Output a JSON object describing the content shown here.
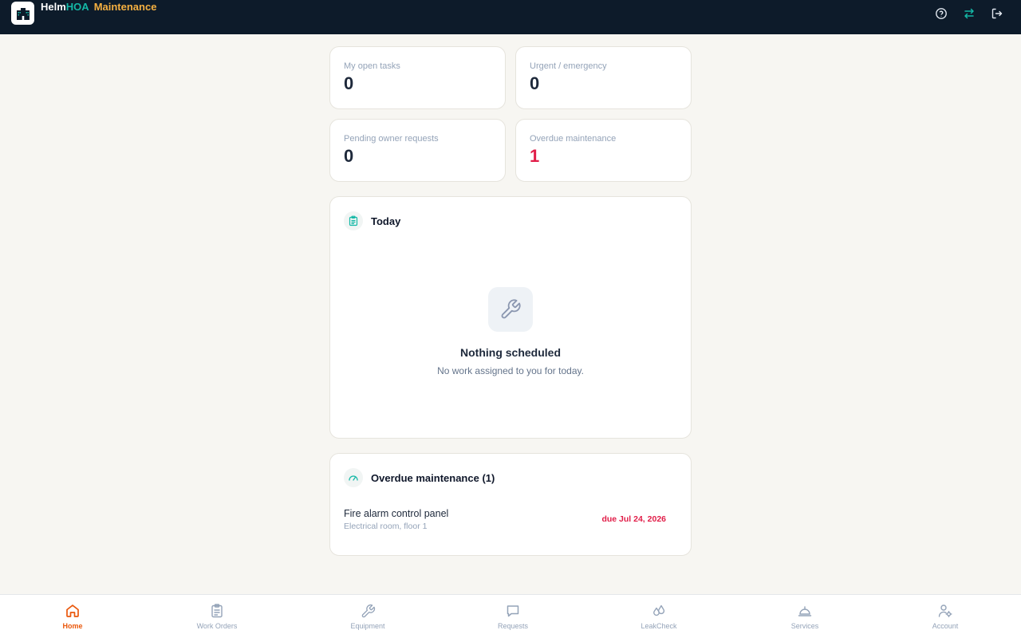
{
  "app": {
    "brand_part1": "Helm",
    "brand_part2": "HOA",
    "brand_part3": "Maintenance"
  },
  "header_icons": [
    "help-circle-icon",
    "switch-arrows-icon",
    "logout-icon"
  ],
  "stats": [
    {
      "label": "My open tasks",
      "value": "0"
    },
    {
      "label": "Urgent / emergency",
      "value": "0"
    },
    {
      "label": "Pending owner requests",
      "value": "0"
    },
    {
      "label": "Overdue maintenance",
      "value": "1"
    }
  ],
  "today": {
    "title": "Today",
    "empty_title": "Nothing scheduled",
    "empty_desc": "No work assigned to you for today."
  },
  "overdue": {
    "title": "Overdue maintenance (1)",
    "items": [
      {
        "name": "Fire alarm control panel",
        "location": "Electrical room, floor 1",
        "due": "due Jul 24, 2026"
      }
    ]
  },
  "nav": {
    "items": [
      {
        "label": "Home",
        "icon": "home-icon",
        "active": true
      },
      {
        "label": "Work Orders",
        "icon": "clipboard-icon"
      },
      {
        "label": "Equipment",
        "icon": "wrench-icon"
      },
      {
        "label": "Requests",
        "icon": "chat-icon"
      },
      {
        "label": "LeakCheck",
        "icon": "droplets-icon"
      },
      {
        "label": "Services",
        "icon": "service-bell-icon"
      },
      {
        "label": "Account",
        "icon": "user-settings-icon"
      }
    ]
  },
  "colors": {
    "header_bg": "#0d1b2a",
    "accent_teal": "#14b8a6",
    "accent_amber": "#f5b041",
    "active_nav": "#ea580c",
    "danger": "#e11d48",
    "page_bg": "#f7f6f2"
  }
}
